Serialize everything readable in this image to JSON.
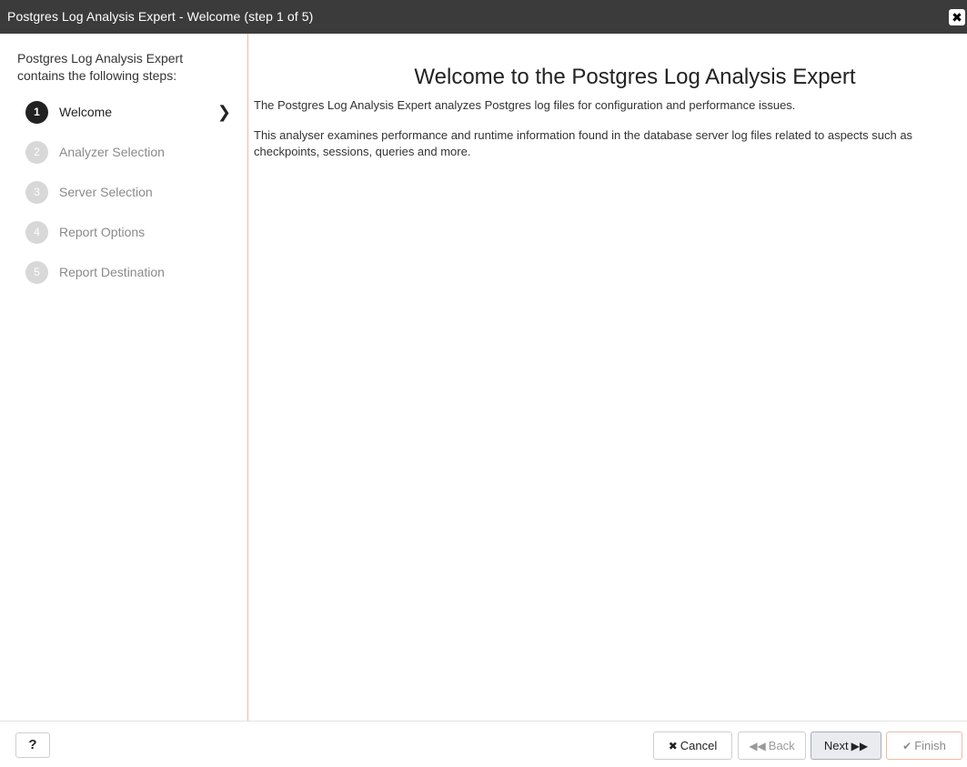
{
  "window": {
    "title": "Postgres Log Analysis Expert - Welcome (step 1 of 5)",
    "close_icon": "close-icon"
  },
  "sidebar": {
    "intro": "Postgres Log Analysis Expert contains the following steps:",
    "steps": [
      {
        "num": "1",
        "label": "Welcome",
        "active": true
      },
      {
        "num": "2",
        "label": "Analyzer Selection",
        "active": false
      },
      {
        "num": "3",
        "label": "Server Selection",
        "active": false
      },
      {
        "num": "4",
        "label": "Report Options",
        "active": false
      },
      {
        "num": "5",
        "label": "Report Destination",
        "active": false
      }
    ],
    "active_arrow": "chevron-right-icon"
  },
  "main": {
    "title": "Welcome to the Postgres Log Analysis Expert",
    "paragraph1": "The Postgres Log Analysis Expert analyzes Postgres log files for configuration and performance issues.",
    "paragraph2": "This analyser examines performance and runtime information found in the database server log files related to aspects such as checkpoints, sessions, queries and more."
  },
  "footer": {
    "help_label": "?",
    "cancel_label": "Cancel",
    "back_label": "Back",
    "next_label": "Next",
    "finish_label": "Finish"
  },
  "colors": {
    "titlebar": "#3b3b3b",
    "active_step": "#222222",
    "inactive_step": "#d8d8d8",
    "divider_accent": "#f0b9a4"
  }
}
